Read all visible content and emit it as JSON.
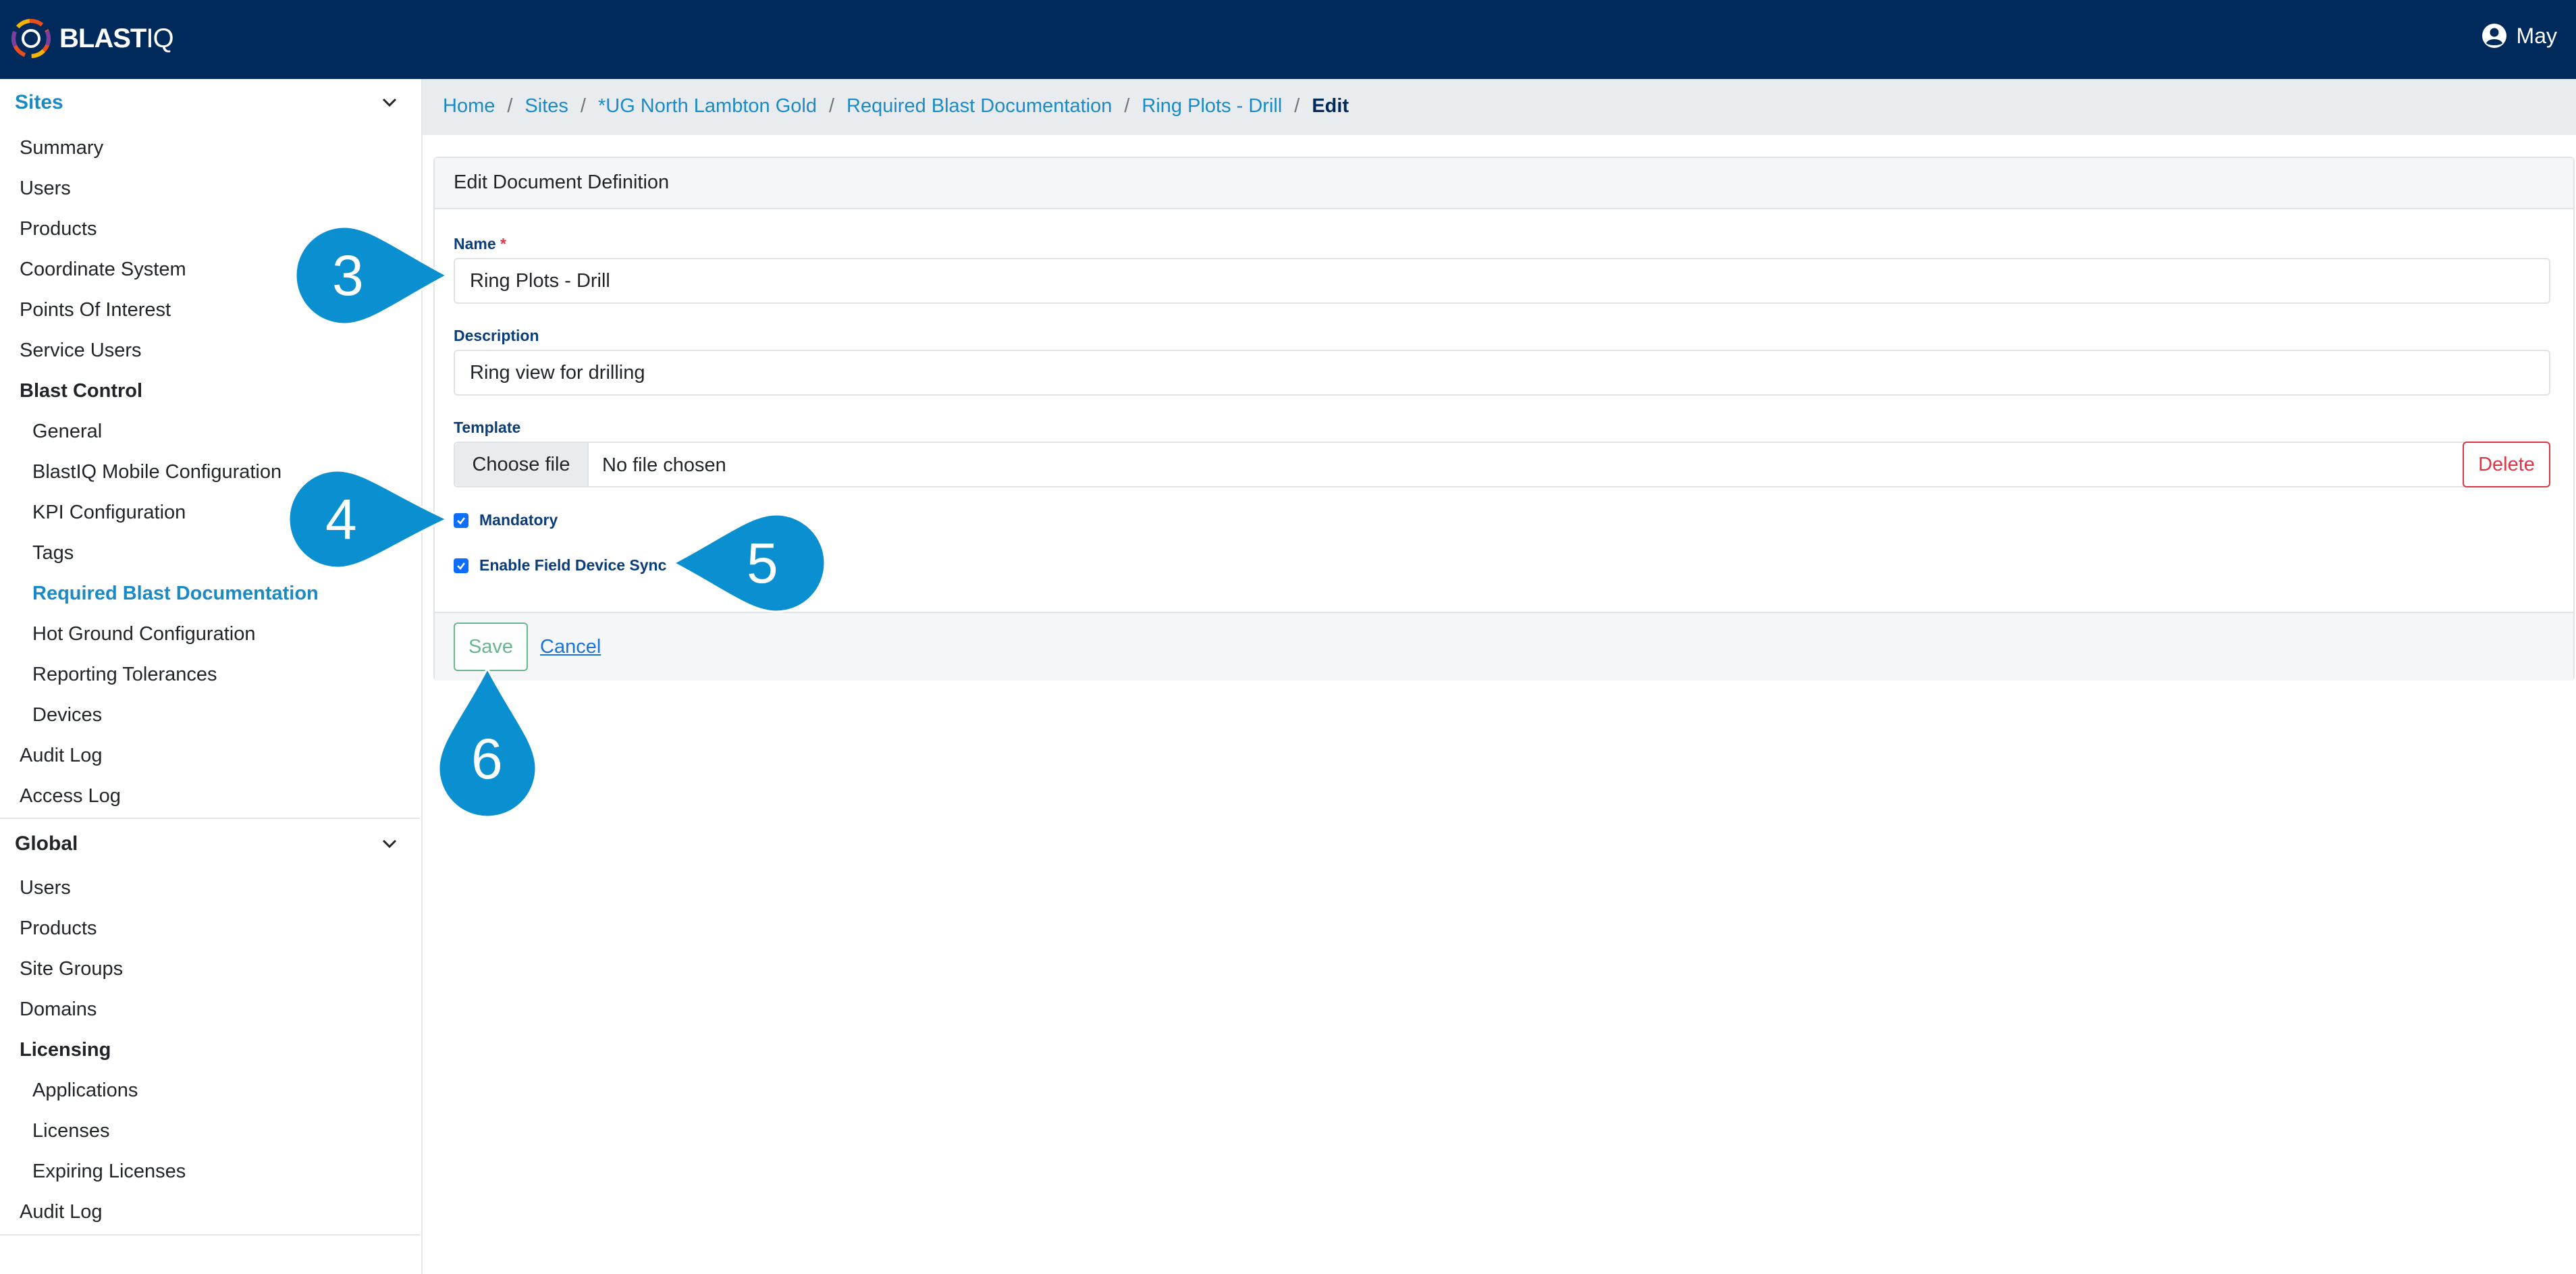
{
  "app": {
    "logo_primary": "BLAST",
    "logo_secondary": "IQ",
    "user_name": "May"
  },
  "sidebar": {
    "sites_header": "Sites",
    "sites_items": [
      {
        "label": "Summary",
        "style": "normal"
      },
      {
        "label": "Users",
        "style": "normal"
      },
      {
        "label": "Products",
        "style": "normal"
      },
      {
        "label": "Coordinate System",
        "style": "normal"
      },
      {
        "label": "Points Of Interest",
        "style": "normal"
      },
      {
        "label": "Service Users",
        "style": "normal"
      },
      {
        "label": "Blast Control",
        "style": "bold"
      },
      {
        "label": "General",
        "style": "sub"
      },
      {
        "label": "BlastIQ Mobile Configuration",
        "style": "sub"
      },
      {
        "label": "KPI Configuration",
        "style": "sub"
      },
      {
        "label": "Tags",
        "style": "sub"
      },
      {
        "label": "Required Blast Documentation",
        "style": "active"
      },
      {
        "label": "Hot Ground Configuration",
        "style": "sub"
      },
      {
        "label": "Reporting Tolerances",
        "style": "sub"
      },
      {
        "label": "Devices",
        "style": "sub"
      },
      {
        "label": "Audit Log",
        "style": "normal"
      },
      {
        "label": "Access Log",
        "style": "normal"
      }
    ],
    "global_header": "Global",
    "global_items": [
      {
        "label": "Users",
        "style": "normal"
      },
      {
        "label": "Products",
        "style": "normal"
      },
      {
        "label": "Site Groups",
        "style": "normal"
      },
      {
        "label": "Domains",
        "style": "normal"
      },
      {
        "label": "Licensing",
        "style": "bold"
      },
      {
        "label": "Applications",
        "style": "sub"
      },
      {
        "label": "Licenses",
        "style": "sub"
      },
      {
        "label": "Expiring Licenses",
        "style": "sub"
      },
      {
        "label": "Audit Log",
        "style": "normal"
      }
    ]
  },
  "breadcrumb": {
    "links": [
      "Home",
      "Sites",
      "*UG North Lambton Gold",
      "Required Blast Documentation",
      "Ring Plots - Drill"
    ],
    "current": "Edit"
  },
  "form": {
    "title": "Edit Document Definition",
    "name_label": "Name",
    "required_mark": "*",
    "name_value": "Ring Plots - Drill",
    "description_label": "Description",
    "description_value": "Ring view for drilling",
    "template_label": "Template",
    "choose_file_label": "Choose file",
    "no_file_text": "No file chosen",
    "delete_label": "Delete",
    "mandatory_label": "Mandatory",
    "mandatory_checked": true,
    "sync_label": "Enable Field Device Sync",
    "sync_checked": true,
    "save_label": "Save",
    "cancel_label": "Cancel"
  },
  "callouts": [
    "3",
    "4",
    "5",
    "6"
  ],
  "colors": {
    "topbar": "#002a5c",
    "link": "#1a8ac6",
    "callout": "#0a8fd0",
    "danger": "#dc3545",
    "success": "#5cae87"
  }
}
